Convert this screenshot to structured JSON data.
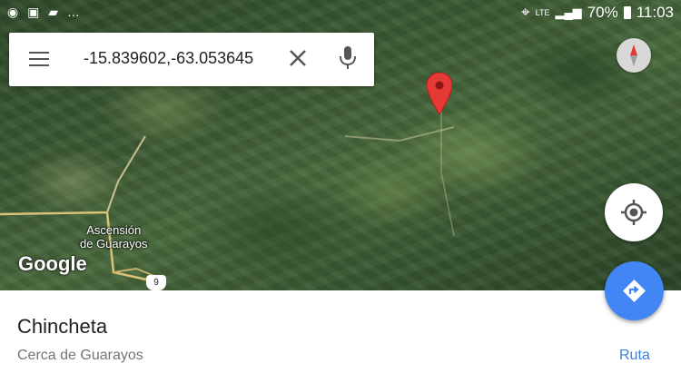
{
  "status_bar": {
    "left_icons": [
      "whatsapp-icon",
      "image-icon",
      "message-icon",
      "more-notifications-icon"
    ],
    "network": "LTE",
    "battery": "70%",
    "time": "11:03"
  },
  "search": {
    "query": "-15.839602,-63.053645"
  },
  "map": {
    "town_label_line1": "Ascensión",
    "town_label_line2": "de Guarayos",
    "route_shield": "9",
    "logo": "Google"
  },
  "place": {
    "title": "Chincheta",
    "subtitle": "Cerca de Guarayos",
    "route_label": "Ruta"
  },
  "colors": {
    "accent": "#4285f4",
    "link": "#3f7ed8",
    "pin": "#e53935"
  }
}
